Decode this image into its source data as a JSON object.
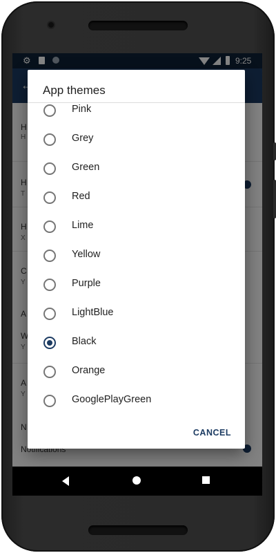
{
  "status_bar": {
    "time": "9:25",
    "left_icons": [
      "gear-icon",
      "sd-card-icon",
      "circle-icon"
    ],
    "right_icons": [
      "wifi-icon",
      "signal-icon",
      "battery-icon"
    ]
  },
  "background": {
    "toolbar_back_icon": "back-arrow-icon",
    "items": [
      {
        "title": "H",
        "subtitle": "H"
      },
      {
        "title": "H",
        "subtitle": "T"
      },
      {
        "title": "H",
        "subtitle": "X"
      },
      {
        "title": "C",
        "subtitle": "Y"
      },
      {
        "title": "A",
        "subtitle": ""
      },
      {
        "title": "W",
        "subtitle": "Y"
      },
      {
        "title": "A",
        "subtitle": "Y"
      },
      {
        "title": "N",
        "subtitle": ""
      },
      {
        "title": "Notifications",
        "subtitle": ""
      }
    ]
  },
  "dialog": {
    "title": "App themes",
    "options": [
      {
        "label": "Pink",
        "checked": false
      },
      {
        "label": "Grey",
        "checked": false
      },
      {
        "label": "Green",
        "checked": false
      },
      {
        "label": "Red",
        "checked": false
      },
      {
        "label": "Lime",
        "checked": false
      },
      {
        "label": "Yellow",
        "checked": false
      },
      {
        "label": "Purple",
        "checked": false
      },
      {
        "label": "LightBlue",
        "checked": false
      },
      {
        "label": "Black",
        "checked": true
      },
      {
        "label": "Orange",
        "checked": false
      },
      {
        "label": "GooglePlayGreen",
        "checked": false
      }
    ],
    "cancel_label": "CANCEL"
  },
  "nav_bar": {
    "icons": [
      "back-triangle-icon",
      "home-circle-icon",
      "recents-square-icon"
    ]
  },
  "colors": {
    "accent": "#1c3b62",
    "status_bar": "#0f2236",
    "dialog_bg": "#ffffff"
  }
}
